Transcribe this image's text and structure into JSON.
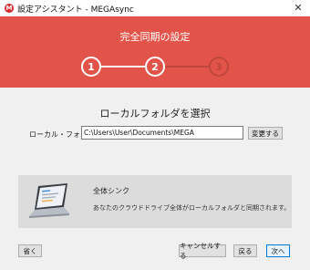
{
  "window": {
    "title": "設定アシスタント - MEGAsync",
    "app_icon_letter": "M",
    "close_glyph": "✕"
  },
  "banner": {
    "title": "完全同期の設定",
    "steps": [
      "1",
      "2",
      "3"
    ],
    "current_step": 2,
    "color": "#e25449"
  },
  "main": {
    "heading": "ローカルフォルダを選択",
    "folder_label": "ローカル・フォルダ",
    "folder_path": "C:\\Users\\User\\Documents\\MEGA",
    "change_button": "変更する"
  },
  "sync_card": {
    "icon": "laptop-icon",
    "title": "全体シンク",
    "description": "あなたのクラウドドライブ全体がローカルフォルダと同期されます。"
  },
  "footer": {
    "skip_button": "省く",
    "cancel_button": "キャンセルする",
    "back_button": "戻る",
    "next_button": "次へ"
  }
}
